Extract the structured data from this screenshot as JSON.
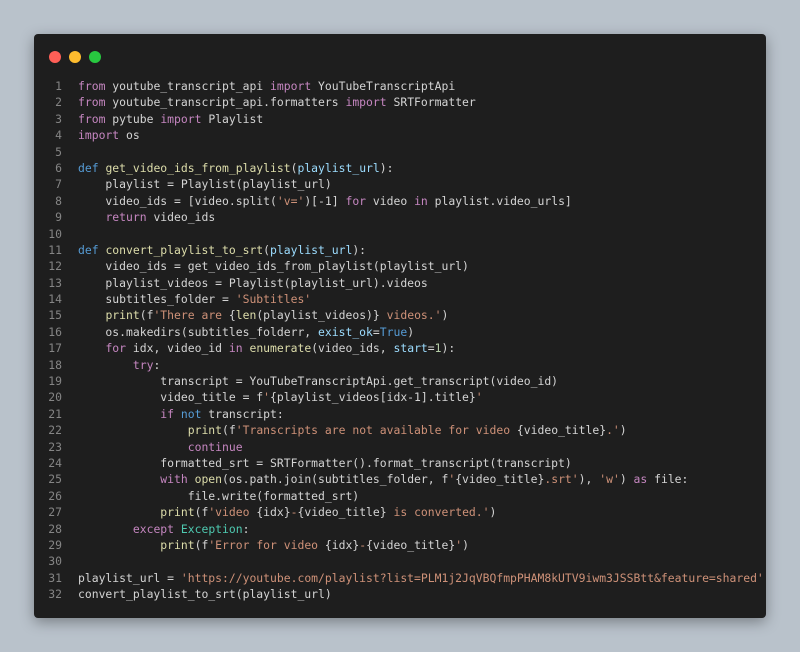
{
  "theme": {
    "dot_colors": [
      "#ff5f57",
      "#febc2e",
      "#28c840"
    ],
    "token_colors": {
      "kw": "#c586c0",
      "def": "#569cd6",
      "fn": "#dcdcaa",
      "cls": "#4ec9b0",
      "str": "#ce9178",
      "num": "#b5cea8",
      "var": "#9cdcfe",
      "txt": "#d4d4d4"
    }
  },
  "window": {
    "controls": [
      {
        "name": "close-dot"
      },
      {
        "name": "minimize-dot"
      },
      {
        "name": "zoom-dot"
      }
    ]
  },
  "code": {
    "lines": [
      {
        "n": "1",
        "tokens": [
          [
            "kw",
            "from"
          ],
          [
            "txt",
            " youtube_transcript_api "
          ],
          [
            "kw",
            "import"
          ],
          [
            "txt",
            " YouTubeTranscriptApi"
          ]
        ]
      },
      {
        "n": "2",
        "tokens": [
          [
            "kw",
            "from"
          ],
          [
            "txt",
            " youtube_transcript_api.formatters "
          ],
          [
            "kw",
            "import"
          ],
          [
            "txt",
            " SRTFormatter"
          ]
        ]
      },
      {
        "n": "3",
        "tokens": [
          [
            "kw",
            "from"
          ],
          [
            "txt",
            " pytube "
          ],
          [
            "kw",
            "import"
          ],
          [
            "txt",
            " Playlist"
          ]
        ]
      },
      {
        "n": "4",
        "tokens": [
          [
            "kw",
            "import"
          ],
          [
            "txt",
            " os"
          ]
        ]
      },
      {
        "n": "5",
        "tokens": []
      },
      {
        "n": "6",
        "tokens": [
          [
            "def",
            "def"
          ],
          [
            "txt",
            " "
          ],
          [
            "fn",
            "get_video_ids_from_playlist"
          ],
          [
            "txt",
            "("
          ],
          [
            "var",
            "playlist_url"
          ],
          [
            "txt",
            "):"
          ]
        ]
      },
      {
        "n": "7",
        "tokens": [
          [
            "txt",
            "    playlist = Playlist(playlist_url)"
          ]
        ]
      },
      {
        "n": "8",
        "tokens": [
          [
            "txt",
            "    video_ids = [video.split("
          ],
          [
            "str",
            "'v='"
          ],
          [
            "txt",
            ")[-1] "
          ],
          [
            "kw",
            "for"
          ],
          [
            "txt",
            " video "
          ],
          [
            "kw",
            "in"
          ],
          [
            "txt",
            " playlist.video_urls]"
          ]
        ]
      },
      {
        "n": "9",
        "tokens": [
          [
            "txt",
            "    "
          ],
          [
            "kw",
            "return"
          ],
          [
            "txt",
            " video_ids"
          ]
        ]
      },
      {
        "n": "10",
        "tokens": []
      },
      {
        "n": "11",
        "tokens": [
          [
            "def",
            "def"
          ],
          [
            "txt",
            " "
          ],
          [
            "fn",
            "convert_playlist_to_srt"
          ],
          [
            "txt",
            "("
          ],
          [
            "var",
            "playlist_url"
          ],
          [
            "txt",
            "):"
          ]
        ]
      },
      {
        "n": "12",
        "tokens": [
          [
            "txt",
            "    video_ids = get_video_ids_from_playlist(playlist_url)"
          ]
        ]
      },
      {
        "n": "13",
        "tokens": [
          [
            "txt",
            "    playlist_videos = Playlist(playlist_url).videos"
          ]
        ]
      },
      {
        "n": "14",
        "tokens": [
          [
            "txt",
            "    subtitles_folder = "
          ],
          [
            "str",
            "'Subtitles'"
          ]
        ]
      },
      {
        "n": "15",
        "tokens": [
          [
            "txt",
            "    "
          ],
          [
            "fn",
            "print"
          ],
          [
            "txt",
            "(f"
          ],
          [
            "str",
            "'There are "
          ],
          [
            "txt",
            "{"
          ],
          [
            "fn",
            "len"
          ],
          [
            "txt",
            "(playlist_videos)}"
          ],
          [
            "str",
            " videos.'"
          ],
          [
            "txt",
            ")"
          ]
        ]
      },
      {
        "n": "16",
        "tokens": [
          [
            "txt",
            "    os.makedirs(subtitles_folderr, "
          ],
          [
            "var",
            "exist_ok"
          ],
          [
            "txt",
            "="
          ],
          [
            "def",
            "True"
          ],
          [
            "txt",
            ")"
          ]
        ]
      },
      {
        "n": "17",
        "tokens": [
          [
            "txt",
            "    "
          ],
          [
            "kw",
            "for"
          ],
          [
            "txt",
            " idx, video_id "
          ],
          [
            "kw",
            "in"
          ],
          [
            "txt",
            " "
          ],
          [
            "fn",
            "enumerate"
          ],
          [
            "txt",
            "(video_ids, "
          ],
          [
            "var",
            "start"
          ],
          [
            "txt",
            "="
          ],
          [
            "num",
            "1"
          ],
          [
            "txt",
            "):"
          ]
        ]
      },
      {
        "n": "18",
        "tokens": [
          [
            "txt",
            "        "
          ],
          [
            "kw",
            "try"
          ],
          [
            "txt",
            ":"
          ]
        ]
      },
      {
        "n": "19",
        "tokens": [
          [
            "txt",
            "            transcript = YouTubeTranscriptApi.get_transcript(video_id)"
          ]
        ]
      },
      {
        "n": "20",
        "tokens": [
          [
            "txt",
            "            video_title = f"
          ],
          [
            "str",
            "'"
          ],
          [
            "txt",
            "{playlist_videos[idx-1].title}"
          ],
          [
            "str",
            "'"
          ]
        ]
      },
      {
        "n": "21",
        "tokens": [
          [
            "txt",
            "            "
          ],
          [
            "kw",
            "if"
          ],
          [
            "txt",
            " "
          ],
          [
            "def",
            "not"
          ],
          [
            "txt",
            " transcript:"
          ]
        ]
      },
      {
        "n": "22",
        "tokens": [
          [
            "txt",
            "                "
          ],
          [
            "fn",
            "print"
          ],
          [
            "txt",
            "(f"
          ],
          [
            "str",
            "'Transcripts are not available for video "
          ],
          [
            "txt",
            "{video_title}"
          ],
          [
            "str",
            ".'"
          ],
          [
            "txt",
            ")"
          ]
        ]
      },
      {
        "n": "23",
        "tokens": [
          [
            "txt",
            "                "
          ],
          [
            "kw",
            "continue"
          ]
        ]
      },
      {
        "n": "24",
        "tokens": [
          [
            "txt",
            "            formatted_srt = SRTFormatter().format_transcript(transcript)"
          ]
        ]
      },
      {
        "n": "25",
        "tokens": [
          [
            "txt",
            "            "
          ],
          [
            "kw",
            "with"
          ],
          [
            "txt",
            " "
          ],
          [
            "fn",
            "open"
          ],
          [
            "txt",
            "(os.path.join(subtitles_folder, f"
          ],
          [
            "str",
            "'"
          ],
          [
            "txt",
            "{video_title}"
          ],
          [
            "str",
            ".srt'"
          ],
          [
            "txt",
            "), "
          ],
          [
            "str",
            "'w'"
          ],
          [
            "txt",
            ") "
          ],
          [
            "kw",
            "as"
          ],
          [
            "txt",
            " file:"
          ]
        ]
      },
      {
        "n": "26",
        "tokens": [
          [
            "txt",
            "                file.write(formatted_srt)"
          ]
        ]
      },
      {
        "n": "27",
        "tokens": [
          [
            "txt",
            "            "
          ],
          [
            "fn",
            "print"
          ],
          [
            "txt",
            "(f"
          ],
          [
            "str",
            "'video "
          ],
          [
            "txt",
            "{idx}"
          ],
          [
            "str",
            "-"
          ],
          [
            "txt",
            "{video_title}"
          ],
          [
            "str",
            " is converted.'"
          ],
          [
            "txt",
            ")"
          ]
        ]
      },
      {
        "n": "28",
        "tokens": [
          [
            "txt",
            "        "
          ],
          [
            "kw",
            "except"
          ],
          [
            "txt",
            " "
          ],
          [
            "cls",
            "Exception"
          ],
          [
            "txt",
            ":"
          ]
        ]
      },
      {
        "n": "29",
        "tokens": [
          [
            "txt",
            "            "
          ],
          [
            "fn",
            "print"
          ],
          [
            "txt",
            "(f"
          ],
          [
            "str",
            "'Error for video "
          ],
          [
            "txt",
            "{idx}"
          ],
          [
            "str",
            "-"
          ],
          [
            "txt",
            "{video_title}"
          ],
          [
            "str",
            "'"
          ],
          [
            "txt",
            ")"
          ]
        ]
      },
      {
        "n": "30",
        "tokens": []
      },
      {
        "n": "31",
        "tokens": [
          [
            "txt",
            "playlist_url = "
          ],
          [
            "str",
            "'https://youtube.com/playlist?list=PLM1j2JqVBQfmpPHAM8kUTV9iwm3JSSBtt&feature=shared'"
          ]
        ]
      },
      {
        "n": "32",
        "tokens": [
          [
            "txt",
            "convert_playlist_to_srt(playlist_url)"
          ]
        ]
      }
    ]
  }
}
